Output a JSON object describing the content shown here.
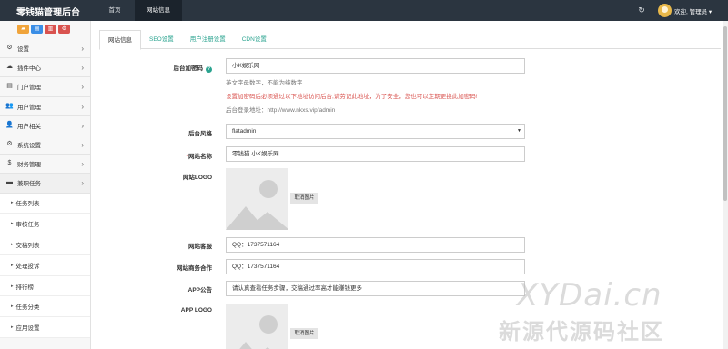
{
  "header": {
    "brand": "零钱猫管理后台",
    "nav": [
      "首页",
      "网站信息"
    ],
    "user": "欢迎, 管理员 ▾",
    "refresh_icon": "refresh-icon"
  },
  "sidebar": {
    "shortcuts": [
      "shortcut-orange",
      "shortcut-blue",
      "shortcut-red",
      "shortcut-red"
    ],
    "items": [
      {
        "label": "设置",
        "icon": "gear-icon"
      },
      {
        "label": "插件中心",
        "icon": "cloud-icon"
      },
      {
        "label": "门户管理",
        "icon": "list-icon"
      },
      {
        "label": "用户管理",
        "icon": "users-icon"
      },
      {
        "label": "用户相关",
        "icon": "user-icon"
      },
      {
        "label": "系统设置",
        "icon": "cogs-icon"
      },
      {
        "label": "财务管理",
        "icon": "money-icon"
      },
      {
        "label": "兼职任务",
        "icon": "folder-icon"
      }
    ],
    "sub_items": [
      "任务列表",
      "审核任务",
      "交稿列表",
      "处理投诉",
      "排行榜",
      "任务分类",
      "应用设置"
    ]
  },
  "tabs": [
    "网站信息",
    "SEO设置",
    "用户注册设置",
    "CDN设置"
  ],
  "form": {
    "admin_code_label": "后台加密码",
    "admin_code_value": "小K娱乐网",
    "hint1": "英文字母数字，不能为纯数字",
    "hint2": "设置加密码后必须通过以下地址访问后台,请劳记此地址，为了安全，您也可以定期更换此加密码!",
    "hint3": "后台登录地址：http://www.nkxs.vip/admin",
    "style_label": "后台风格",
    "style_value": "flatadmin",
    "site_name_label": "网站名称",
    "site_name_value": "零钱猫   小K娱乐网",
    "logo_label": "网站LOGO",
    "cancel_image": "取消图片",
    "service_label": "网站客服",
    "service_value": "QQ：1737571164",
    "business_label": "网站商务合作",
    "business_value": "QQ：1737571164",
    "notice_label": "APP公告",
    "notice_value": "请认真查看任务步骤，交稿通过率高才能赚钱更多",
    "app_logo_label": "APP LOGO",
    "cancel_image2": "取消图片"
  },
  "watermark": {
    "line1": "XYDai.cn",
    "line2": "新源代源码社区"
  },
  "colors": {
    "navbar": "#2b3540",
    "accent": "#2aa38f",
    "danger": "#d9534f"
  }
}
